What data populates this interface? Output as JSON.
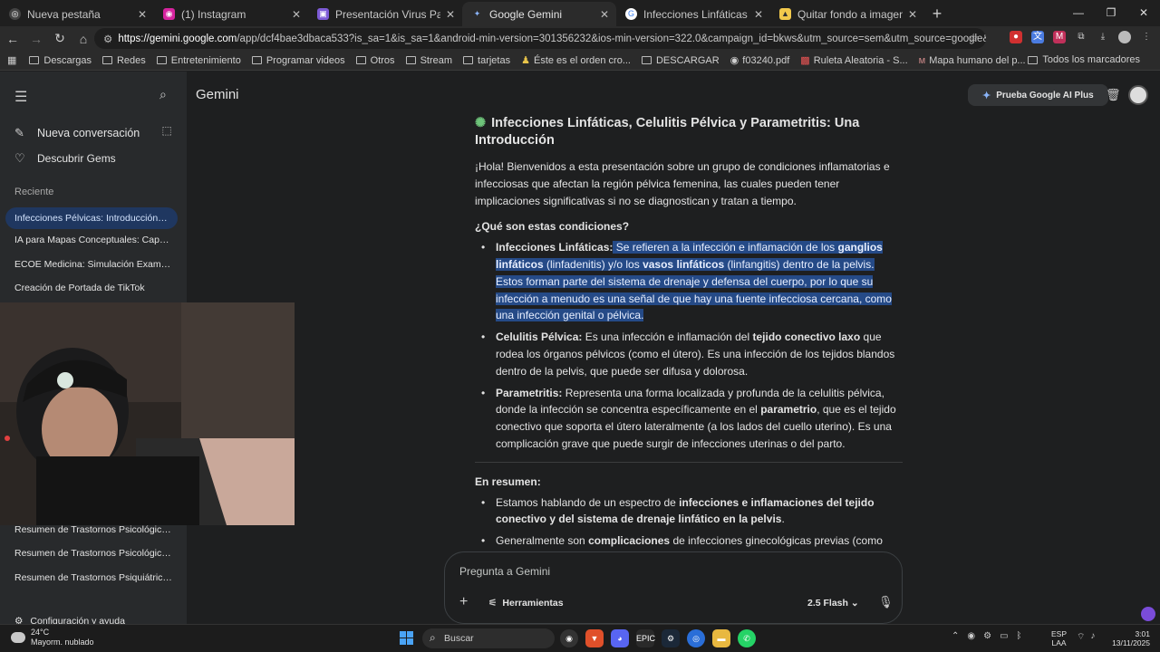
{
  "browser": {
    "tabs": [
      {
        "label": "Nueva pestaña",
        "active": false
      },
      {
        "label": "(1) Instagram",
        "active": false
      },
      {
        "label": "Presentación Virus Papiloma Hu",
        "active": false
      },
      {
        "label": "Google Gemini",
        "active": true
      },
      {
        "label": "Infecciones Linfáticas (Linfaden",
        "active": false
      },
      {
        "label": "Quitar fondo a imagenes online",
        "active": false
      }
    ],
    "url_host": "https://gemini.google.com",
    "url_path": "/app/dcf4bae3dbaca533?is_sa=1&is_sa=1&android-min-version=301356232&ios-min-version=322.0&campaign_id=bkws&utm_source=sem&utm_source=google&utm_medium=paid-media&utm_...",
    "bookmarks": [
      "Descargas",
      "Redes",
      "Entretenimiento",
      "Programar videos",
      "Otros",
      "Stream",
      "tarjetas",
      "Éste es el orden cro...",
      "DESCARGAR",
      "f03240.pdf",
      "Ruleta Aleatoria - S...",
      "Mapa humano del p..."
    ],
    "bookmarks_all": "Todos los marcadores"
  },
  "sidebar": {
    "new_chat": "Nueva conversación",
    "gems": "Descubrir Gems",
    "recent_label": "Reciente",
    "conversations": [
      "Infecciones Pélvicas: Introducción y ...",
      "IA para Mapas Conceptuales: Capaci...",
      "ECOE Medicina: Simulación Examen F...",
      "Creación de Portada de TikTok"
    ],
    "conversations_lower": [
      "Resumen de Trastornos Psicológicos ...",
      "Resumen de Trastornos Psicológicos ...",
      "Resumen de Trastornos Psiquiátricos ..."
    ],
    "settings": "Configuración y ayuda"
  },
  "header": {
    "title": "Gemini",
    "promo": "Prueba Google AI Plus"
  },
  "response": {
    "title": "Infecciones Linfáticas, Celulitis Pélvica y Parametritis: Una Introducción",
    "intro": "¡Hola! Bienvenidos a esta presentación sobre un grupo de condiciones inflamatorias e infecciosas que afectan la región pélvica femenina, las cuales pueden tener implicaciones significativas si no se diagnostican y tratan a tiempo.",
    "q_heading": "¿Qué son estas condiciones?",
    "b1_term": "Infecciones Linfáticas:",
    "b1_t1": " Se refieren a la infección e inflamación de los ",
    "b1_b1": "ganglios linfáticos",
    "b1_t2": " (linfadenitis) y/o los ",
    "b1_b2": "vasos linfáticos",
    "b1_t3": " (linfangitis) dentro de la pelvis. Estos forman parte del sistema de drenaje y defensa del cuerpo, por lo que su infección a menudo es una señal de que hay una fuente infecciosa cercana, como una infección genital o pélvica.",
    "b2_term": "Celulitis Pélvica:",
    "b2_t1": " Es una infección e inflamación del ",
    "b2_b1": "tejido conectivo laxo",
    "b2_t2": " que rodea los órganos pélvicos (como el útero). Es una infección de los tejidos blandos dentro de la pelvis, que puede ser difusa y dolorosa.",
    "b3_term": "Parametritis:",
    "b3_t1": " Representa una forma localizada y profunda de la celulitis pélvica, donde la infección se concentra específicamente en el ",
    "b3_b1": "parametrio",
    "b3_t2": ", que es el tejido conectivo que soporta el útero lateralmente (a los lados del cuello uterino). Es una complicación grave que puede surgir de infecciones uterinas o del parto.",
    "summary_heading": "En resumen:",
    "s1_t1": "Estamos hablando de un espectro de ",
    "s1_b1": "infecciones e inflamaciones del tejido conectivo y del sistema de drenaje linfático en la pelvis",
    "s1_t2": ".",
    "s2_t1": "Generalmente son ",
    "s2_b1": "complicaciones",
    "s2_t2": " de infecciones ginecológicas previas (como una enfermedad inflamatoria pélvica, infecciones postparto o postquirúrgicas)."
  },
  "composer": {
    "placeholder": "Pregunta a Gemini",
    "tools": "Herramientas",
    "model": "2.5 Flash"
  },
  "taskbar": {
    "temp": "24°C",
    "weather": "Mayorm. nublado",
    "search": "Buscar",
    "lang1": "ESP",
    "lang2": "LAA",
    "time": "3:01",
    "date": "13/11/2025"
  },
  "colors": {
    "selection": "#254a87",
    "active_conv": "#1f3760",
    "accent": "#8ab4f8"
  }
}
